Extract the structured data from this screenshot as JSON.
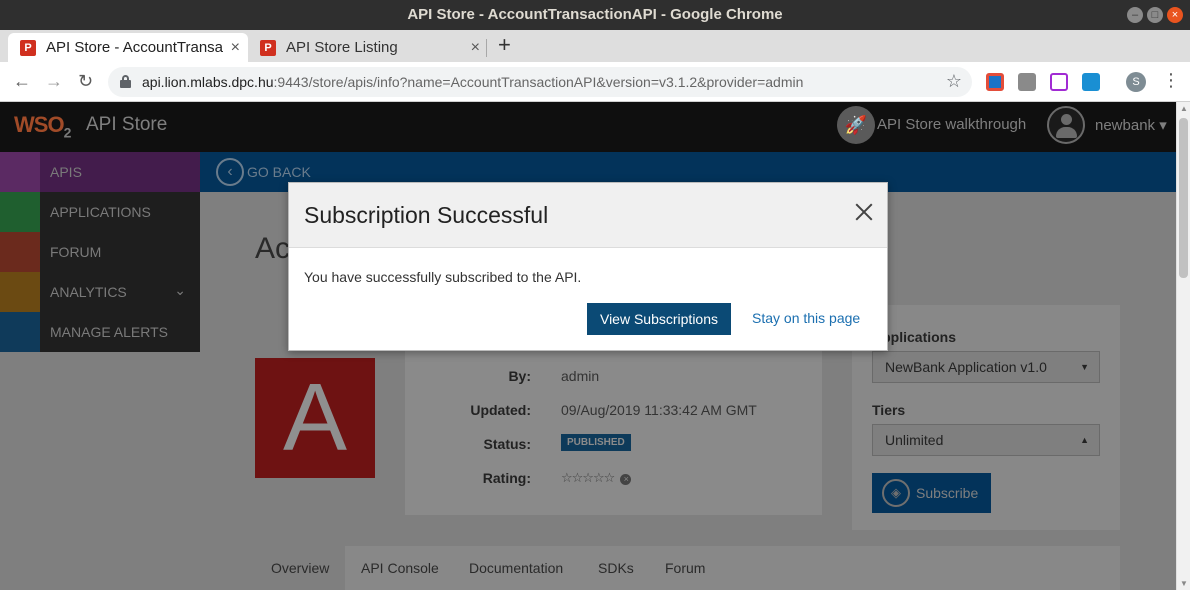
{
  "window": {
    "title": "API Store - AccountTransactionAPI - Google Chrome",
    "controls": {
      "minimize": "–",
      "maximize": "□",
      "close": "×"
    }
  },
  "tabs": [
    {
      "label": "API Store - AccountTransa",
      "close": "×"
    },
    {
      "label": "API Store Listing",
      "close": "×"
    }
  ],
  "new_tab_label": "+",
  "toolbar": {
    "back": "←",
    "forward": "→",
    "reload": "↻",
    "url_host": "api.lion.mlabs.dpc.hu",
    "url_rest": ":9443/store/apis/info?name=AccountTransactionAPI&version=v3.1.2&provider=admin",
    "star": "☆",
    "profile_initial": "S",
    "menu": "⋮"
  },
  "app": {
    "logo_main": "WSO",
    "logo_sub": "2",
    "brand": "API Store",
    "walkthrough_label": "API Store walkthrough",
    "walkthrough_icon": "🚀",
    "user_name": "newbank ▾"
  },
  "sidebar": {
    "items": [
      {
        "label": "APIS",
        "icon": "gear-icon",
        "color": "#5b2a63"
      },
      {
        "label": "APPLICATIONS",
        "icon": "applications-icon",
        "color": "#1f5f2f"
      },
      {
        "label": "FORUM",
        "icon": "forum-icon",
        "color": "#6b2a1d"
      },
      {
        "label": "ANALYTICS",
        "icon": "analytics-icon",
        "color": "#6b4a12",
        "chevron": "⌄"
      },
      {
        "label": "MANAGE ALERTS",
        "icon": "bell-icon",
        "color": "#0f3a5a"
      }
    ]
  },
  "goback": {
    "label": "GO BACK",
    "icon": "‹"
  },
  "api": {
    "title_fragment": "Ac",
    "thumbnail_letter": "A",
    "by_label": "By:",
    "by_value": "admin",
    "updated_label": "Updated:",
    "updated_value": "09/Aug/2019 11:33:42 AM GMT",
    "status_label": "Status:",
    "status_value": "PUBLISHED",
    "rating_label": "Rating:",
    "rating_stars": "☆☆☆☆☆",
    "rating_clear": "×"
  },
  "subscription": {
    "applications_label": "Applications",
    "application_value": "NewBank Application v1.0",
    "tiers_label": "Tiers",
    "tier_value": "Unlimited",
    "subscribe_label": "Subscribe",
    "caret_down": "▼",
    "caret_up": "▲"
  },
  "content_tabs": [
    "Overview",
    "API Console",
    "Documentation",
    "SDKs",
    "Forum"
  ],
  "modal": {
    "title": "Subscription Successful",
    "message": "You have successfully subscribed to the API.",
    "primary_button": "View Subscriptions",
    "secondary_link": "Stay on this page"
  },
  "colors": {
    "accent_blue": "#0b4a75",
    "link_blue": "#1b6fb0",
    "published_badge": "#0d3a5a"
  }
}
